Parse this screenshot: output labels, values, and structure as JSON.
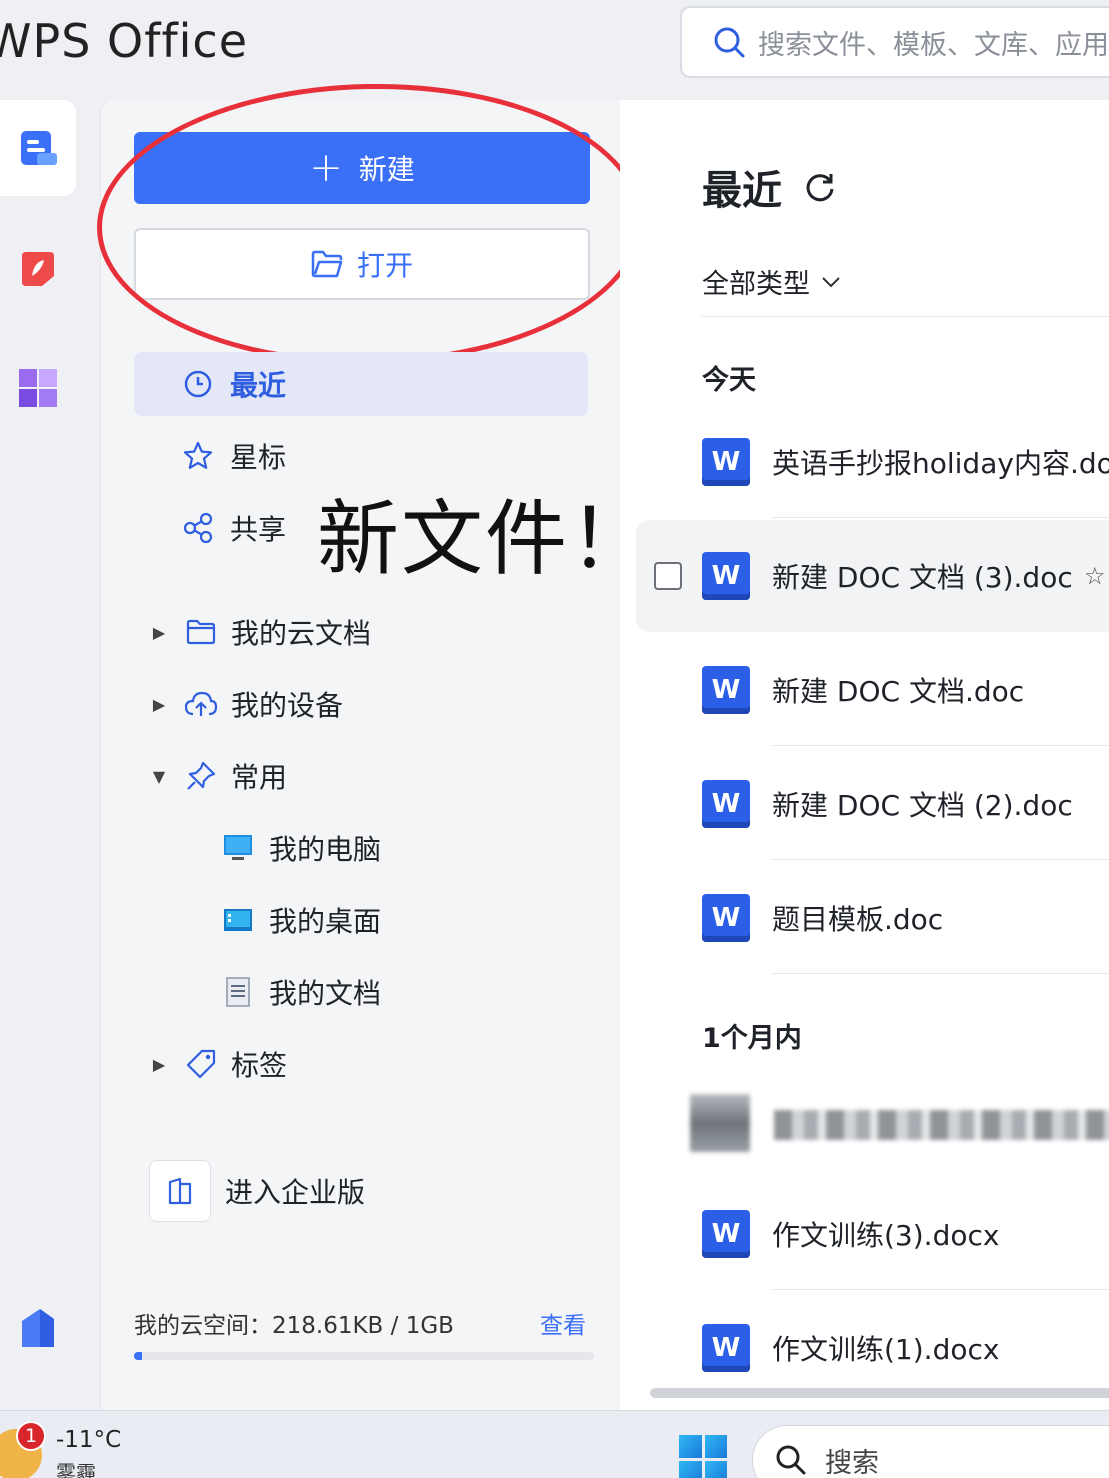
{
  "header": {
    "logo": "WPS Office",
    "search_placeholder": "搜索文件、模板、文库、应用"
  },
  "sidebar": {
    "new_label": "新建",
    "open_label": "打开",
    "nav": [
      {
        "label": "最近"
      },
      {
        "label": "星标"
      },
      {
        "label": "共享"
      }
    ],
    "tree": [
      {
        "label": "我的云文档"
      },
      {
        "label": "我的设备"
      },
      {
        "label": "常用"
      },
      {
        "label": "标签"
      }
    ],
    "common_items": [
      {
        "label": "我的电脑"
      },
      {
        "label": "我的桌面"
      },
      {
        "label": "我的文档"
      }
    ],
    "enterprise_label": "进入企业版",
    "storage_text": "我的云空间：218.61KB / 1GB",
    "storage_view": "查看",
    "storage_fraction": 0.0002
  },
  "annotation": {
    "text": "新文件！",
    "ellipse_color": "#e8303a"
  },
  "main": {
    "title": "最近",
    "filter_label": "全部类型",
    "groups": {
      "today": "今天",
      "month": "1个月内"
    },
    "files_today": [
      {
        "name": "英语手抄报holiday内容.doc"
      },
      {
        "name": "新建 DOC 文档 (3).doc"
      },
      {
        "name": "新建 DOC 文档.doc"
      },
      {
        "name": "新建 DOC 文档 (2).doc"
      },
      {
        "name": "题目模板.doc"
      }
    ],
    "files_month": [
      {
        "name": "作文训练(3).docx"
      },
      {
        "name": "作文训练(1).docx"
      }
    ],
    "word_icon_letter": "W"
  },
  "taskbar": {
    "badge": "1",
    "temperature": "-11°C",
    "condition": "雾霾",
    "search_label": "搜索"
  },
  "colors": {
    "accent": "#3a6ff7",
    "word": "#2b5fe8"
  }
}
